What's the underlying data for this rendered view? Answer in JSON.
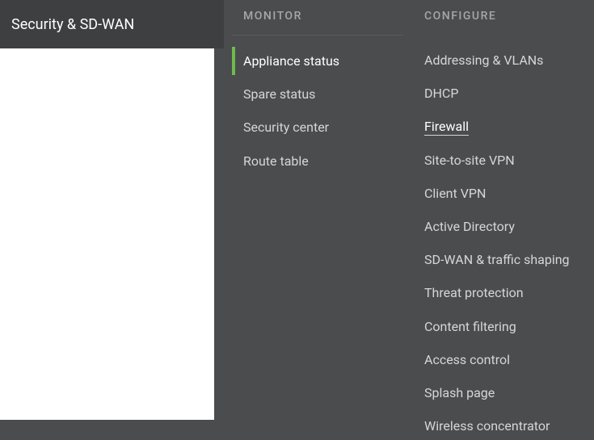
{
  "header": {
    "title": "Security & SD-WAN"
  },
  "menu": {
    "columns": [
      {
        "header": "MONITOR",
        "items": [
          {
            "label": "Appliance status",
            "active": true
          },
          {
            "label": "Spare status"
          },
          {
            "label": "Security center"
          },
          {
            "label": "Route table"
          }
        ]
      },
      {
        "header": "CONFIGURE",
        "items": [
          {
            "label": "Addressing & VLANs"
          },
          {
            "label": "DHCP"
          },
          {
            "label": "Firewall",
            "hovered": true
          },
          {
            "label": "Site-to-site VPN"
          },
          {
            "label": "Client VPN"
          },
          {
            "label": "Active Directory"
          },
          {
            "label": "SD-WAN & traffic shaping"
          },
          {
            "label": "Threat protection"
          },
          {
            "label": "Content filtering"
          },
          {
            "label": "Access control"
          },
          {
            "label": "Splash page"
          },
          {
            "label": "Wireless concentrator"
          }
        ]
      }
    ]
  }
}
